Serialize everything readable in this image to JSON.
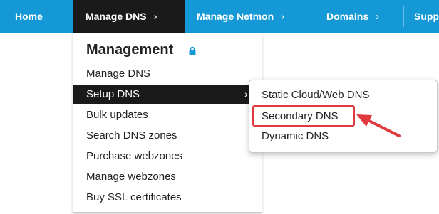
{
  "navbar": {
    "items": [
      {
        "label": "Home"
      },
      {
        "label": "Manage DNS",
        "active": true
      },
      {
        "label": "Manage Netmon"
      },
      {
        "label": "Domains"
      },
      {
        "label": "Supp"
      }
    ],
    "chevron": "›",
    "colors": {
      "bar": "#1598d6",
      "active": "#1a1a1a"
    }
  },
  "management_menu": {
    "heading": "Management",
    "heading_icon": "lock-icon",
    "items": [
      {
        "label": "Manage DNS"
      },
      {
        "label": "Setup DNS",
        "highlighted": true,
        "has_submenu": true
      },
      {
        "label": "Bulk updates"
      },
      {
        "label": "Search DNS zones"
      },
      {
        "label": "Purchase webzones"
      },
      {
        "label": "Manage webzones"
      },
      {
        "label": "Buy SSL certificates"
      }
    ],
    "submenu_chevron": "›"
  },
  "setup_dns_submenu": {
    "items": [
      {
        "label": "Static Cloud/Web DNS"
      },
      {
        "label": "Secondary DNS",
        "annotated": true
      },
      {
        "label": "Dynamic DNS"
      }
    ]
  },
  "annotation": {
    "color": "#e03a3e",
    "icon": "red-arrow-icon"
  }
}
